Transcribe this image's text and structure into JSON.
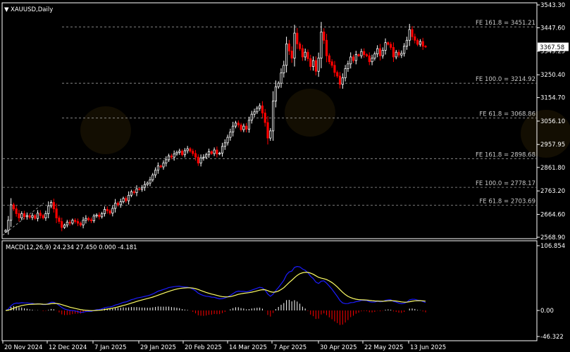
{
  "window": {
    "symbol_label": "XAUUSD,Daily",
    "macd_label": "MACD(12,26,9) 24.234 27.450 0.000 -4.181",
    "current_price_label": "3367.58"
  },
  "colors": {
    "background": "#000000",
    "frame": "#ffffff",
    "bull_candle": "#ffffff",
    "bear_candle": "#ff0000",
    "grid_dashed": "#9a9a9a",
    "macd_line": "#1c1cff",
    "signal_line": "#ffff66",
    "hist_positive": "#ffffff",
    "hist_negative": "#ff0000"
  },
  "chart_data": [
    {
      "type": "candlestick",
      "title": "XAUUSD,Daily",
      "y_ticks": [
        "3543.30",
        "3447.60",
        "3349.25",
        "3250.40",
        "3154.70",
        "3056.10",
        "2957.95",
        "2861.80",
        "2763.20",
        "2664.60",
        "2568.90"
      ],
      "y_tick_values": [
        3543.3,
        3447.6,
        3349.25,
        3250.4,
        3154.7,
        3056.1,
        2957.95,
        2861.8,
        2763.2,
        2664.6,
        2568.9
      ],
      "ylim": [
        2568.9,
        3543.3
      ],
      "x_ticks": [
        "20 Nov 2024",
        "12 Dec 2024",
        "7 Jan 2025",
        "29 Jan 2025",
        "20 Feb 2025",
        "14 Mar 2025",
        "7 Apr 2025",
        "30 Apr 2025",
        "22 May 2025",
        "13 Jun 2025"
      ],
      "current_price": 3367.58,
      "fibonacci_levels": [
        {
          "label": "FE 161.8 = 3451.21",
          "value": 3451.21
        },
        {
          "label": "FE 100.0 = 3214.92",
          "value": 3214.92
        },
        {
          "label": "FE 61.8 = 3068.86",
          "value": 3068.86
        },
        {
          "label": "FE 161.8 = 2898.68",
          "value": 2898.68
        },
        {
          "label": "FE 100.0 = 2778.17",
          "value": 2778.17
        },
        {
          "label": "FE 61.8 = 2703.69",
          "value": 2703.69
        }
      ],
      "closes": [
        2598,
        2640,
        2705,
        2688,
        2668,
        2650,
        2668,
        2655,
        2660,
        2652,
        2660,
        2648,
        2670,
        2660,
        2650,
        2668,
        2700,
        2715,
        2688,
        2650,
        2635,
        2610,
        2620,
        2632,
        2628,
        2640,
        2635,
        2628,
        2620,
        2640,
        2648,
        2642,
        2638,
        2658,
        2662,
        2655,
        2668,
        2686,
        2680,
        2670,
        2690,
        2712,
        2705,
        2718,
        2732,
        2722,
        2745,
        2760,
        2756,
        2772,
        2770,
        2778,
        2790,
        2796,
        2810,
        2830,
        2850,
        2868,
        2864,
        2880,
        2894,
        2910,
        2905,
        2918,
        2925,
        2930,
        2915,
        2932,
        2940,
        2930,
        2920,
        2905,
        2880,
        2902,
        2905,
        2915,
        2928,
        2920,
        2935,
        2918,
        2922,
        2950,
        2965,
        2988,
        3010,
        3035,
        3048,
        3040,
        3020,
        3035,
        3022,
        3060,
        3085,
        3095,
        3110,
        3120,
        3090,
        3050,
        2985,
        3015,
        3140,
        3200,
        3215,
        3258,
        3290,
        3380,
        3350,
        3320,
        3425,
        3380,
        3360,
        3325,
        3345,
        3318,
        3285,
        3310,
        3265,
        3320,
        3430,
        3395,
        3330,
        3305,
        3290,
        3260,
        3245,
        3210,
        3238,
        3276,
        3296,
        3325,
        3310,
        3335,
        3330,
        3348,
        3335,
        3330,
        3305,
        3320,
        3338,
        3360,
        3330,
        3353,
        3385,
        3378,
        3365,
        3325,
        3345,
        3333,
        3340,
        3370,
        3395,
        3440,
        3410,
        3395,
        3378,
        3390,
        3370,
        3367.58
      ]
    },
    {
      "type": "line",
      "title": "MACD(12,26,9)",
      "values_label": "24.234 27.450 0.000 -4.181",
      "macd": 24.234,
      "signal": 27.45,
      "y_ticks": [
        "106.854",
        "0.00",
        "-46.322"
      ],
      "ylim": [
        -46.322,
        106.854
      ]
    }
  ]
}
